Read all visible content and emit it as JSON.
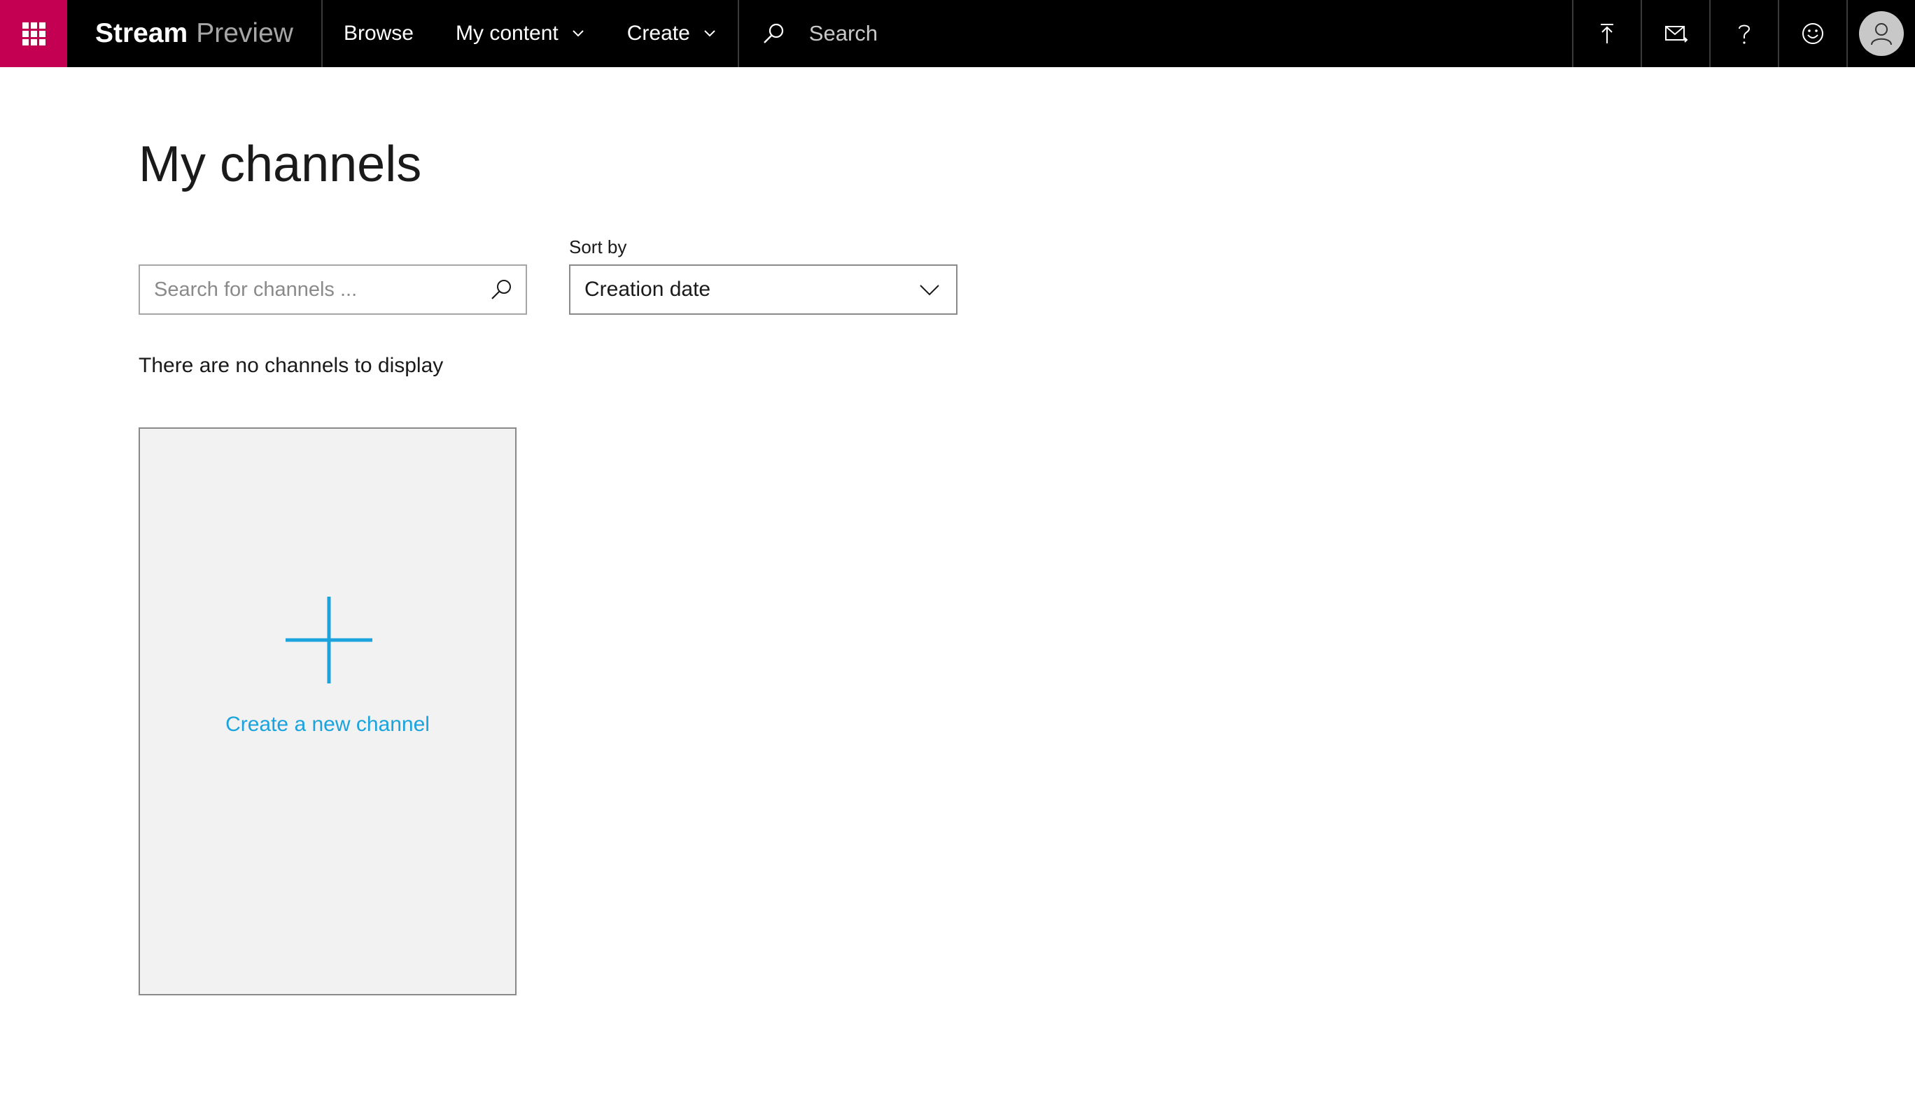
{
  "header": {
    "brand_name": "Stream",
    "brand_sub": "Preview",
    "nav": [
      {
        "label": "Browse",
        "has_dropdown": false
      },
      {
        "label": "My content",
        "has_dropdown": true
      },
      {
        "label": "Create",
        "has_dropdown": true
      }
    ],
    "search_placeholder": "Search",
    "icons": [
      "app-launcher-icon",
      "upload-icon",
      "invite-icon",
      "help-icon",
      "feedback-smiley-icon",
      "avatar-icon"
    ],
    "colors": {
      "bar": "#000000",
      "launcher": "#c30052"
    }
  },
  "main": {
    "title": "My channels",
    "channel_search": {
      "placeholder": "Search for channels ...",
      "value": ""
    },
    "sort": {
      "label": "Sort by",
      "selected": "Creation date"
    },
    "empty_message": "There are no channels to display",
    "create_card": {
      "label": "Create a new channel",
      "accent": "#1aa3dd"
    }
  }
}
